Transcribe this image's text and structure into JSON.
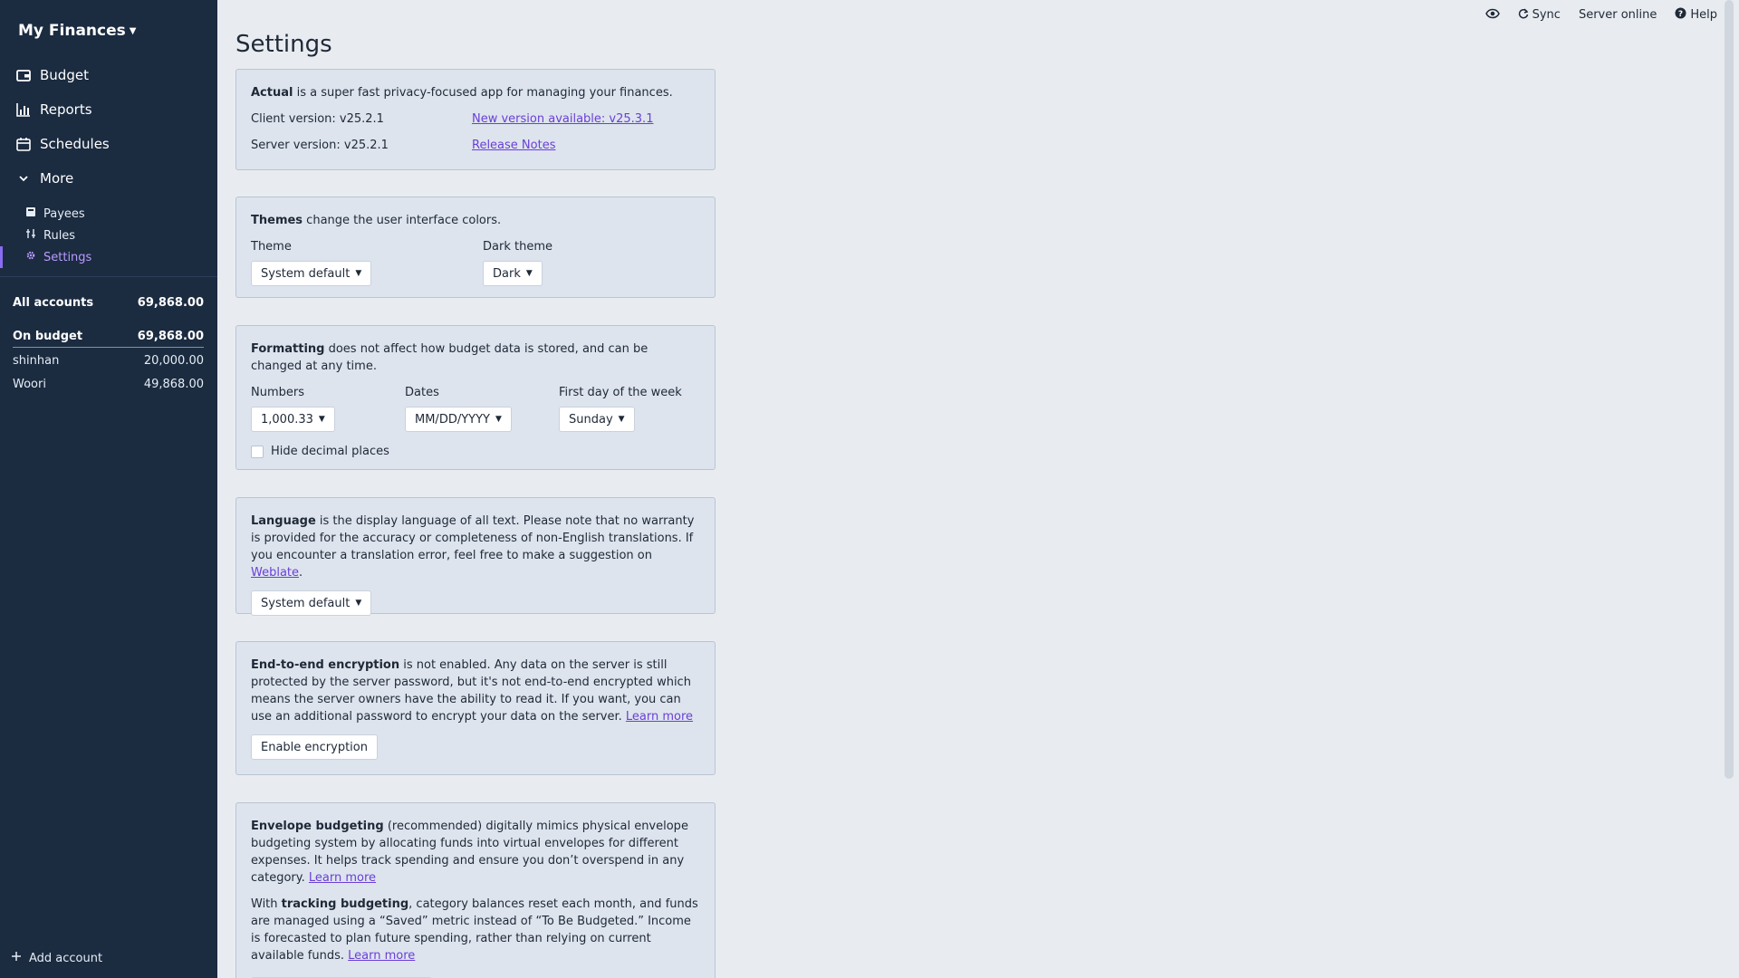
{
  "sidebar": {
    "budget_name": "My Finances",
    "nav": [
      {
        "label": "Budget",
        "icon": "wallet-icon"
      },
      {
        "label": "Reports",
        "icon": "bar-chart-icon"
      },
      {
        "label": "Schedules",
        "icon": "calendar-icon"
      },
      {
        "label": "More",
        "icon": "chevron-down-icon"
      }
    ],
    "sub": [
      {
        "label": "Payees",
        "icon": "payees-icon"
      },
      {
        "label": "Rules",
        "icon": "sliders-icon"
      },
      {
        "label": "Settings",
        "icon": "gear-icon"
      }
    ],
    "accounts": {
      "all_label": "All accounts",
      "all_value": "69,868.00",
      "on_budget_label": "On budget",
      "on_budget_value": "69,868.00",
      "items": [
        {
          "name": "shinhan",
          "value": "20,000.00"
        },
        {
          "name": "Woori",
          "value": "49,868.00"
        }
      ]
    },
    "add_account": "Add account"
  },
  "topbar": {
    "sync": "Sync",
    "status": "Server online",
    "help": "Help"
  },
  "main": {
    "title": "Settings",
    "about": {
      "app_name": "Actual",
      "desc": " is a super fast privacy-focused app for managing your finances.",
      "client_version": "Client version: v25.2.1",
      "new_version": "New version available: v25.3.1",
      "server_version": "Server version: v25.2.1",
      "release_notes": "Release Notes"
    },
    "themes": {
      "heading": "Themes",
      "desc": " change the user interface colors.",
      "theme_label": "Theme",
      "theme_value": "System default",
      "dark_label": "Dark theme",
      "dark_value": "Dark"
    },
    "formatting": {
      "heading": "Formatting",
      "desc": " does not affect how budget data is stored, and can be changed at any time.",
      "numbers_label": "Numbers",
      "numbers_value": "1,000.33",
      "dates_label": "Dates",
      "dates_value": "MM/DD/YYYY",
      "week_label": "First day of the week",
      "week_value": "Sunday",
      "hide_decimal": "Hide decimal places"
    },
    "language": {
      "heading": "Language",
      "desc": " is the display language of all text. Please note that no warranty is provided for the accuracy or completeness of non-English translations. If you encounter a translation error, feel free to make a suggestion on ",
      "link": "Weblate",
      "end": ".",
      "value": "System default"
    },
    "encryption": {
      "heading": "End-to-end encryption",
      "desc": " is not enabled. Any data on the server is still protected by the server password, but it's not end-to-end encrypted which means the server owners have the ability to read it. If you want, you can use an additional password to encrypt your data on the server. ",
      "link": "Learn more",
      "button": "Enable encryption"
    },
    "budgeting": {
      "heading": "Envelope budgeting",
      "desc": " (recommended) digitally mimics physical envelope budgeting system by allocating funds into virtual envelopes for different expenses. It helps track spending and ensure you don’t overspend in any category. ",
      "link": "Learn more",
      "p2_pre": "With ",
      "p2_bold": "tracking budgeting",
      "p2_desc": ", category balances reset each month, and funds are managed using a “Saved” metric instead of “To Be Budgeted.” Income is forecasted to plan future spending, rather than relying on current available funds. ",
      "p2_link": "Learn more"
    }
  }
}
